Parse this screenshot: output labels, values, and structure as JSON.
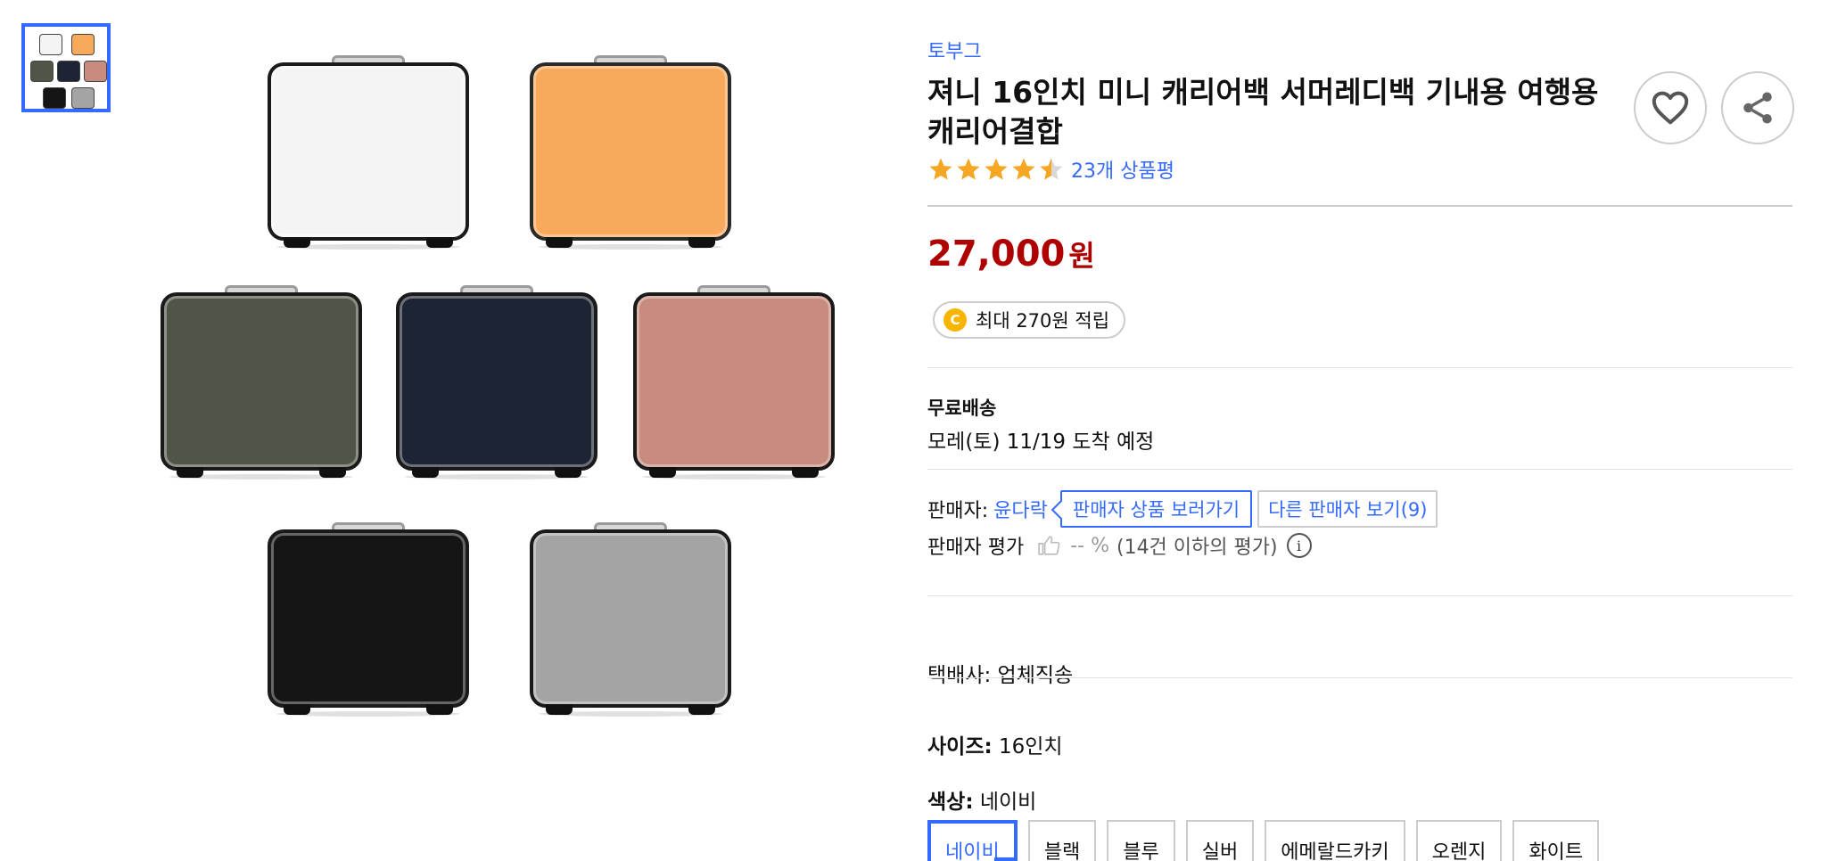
{
  "brand": "토부그",
  "title": "져니 16인치 미니 캐리어백 서머레디백 기내용 여행용 캐리어결합",
  "rating": {
    "value": 4.5,
    "max": 5,
    "review_text": "23개 상품평"
  },
  "price": {
    "amount": "27,000",
    "unit": "원"
  },
  "cashback": {
    "coin_letter": "C",
    "text": "최대 270원 적립"
  },
  "shipping": {
    "title": "무료배송",
    "date": "모레(토) 11/19 도착 예정"
  },
  "seller": {
    "label": "판매자:",
    "name": "윤다락",
    "view_products_button": "판매자 상품 보러가기",
    "other_sellers_button": "다른 판매자 보기(9)"
  },
  "seller_eval": {
    "label": "판매자 평가",
    "value": "-- %",
    "note": "(14건 이하의 평가)",
    "info_glyph": "i"
  },
  "courier": "택배사: 업체직송",
  "size": {
    "label": "사이즈:",
    "value": "16인치"
  },
  "color": {
    "label": "색상:",
    "value": "네이비"
  },
  "color_options": [
    "네이비",
    "블랙",
    "블루",
    "실버",
    "에메랄드카키",
    "오렌지",
    "화이트"
  ],
  "selected_option_index": 0,
  "colors": {
    "accent": "#346aff",
    "price": "#ae0000",
    "star": "#f5a623",
    "case_white": "#f4f4f4",
    "case_orange": "#f8a95c",
    "case_khaki": "#4f5547",
    "case_navy": "#1d2433",
    "case_pink": "#c88c7f",
    "case_black": "#151515",
    "case_gray": "#a4a4a4"
  }
}
